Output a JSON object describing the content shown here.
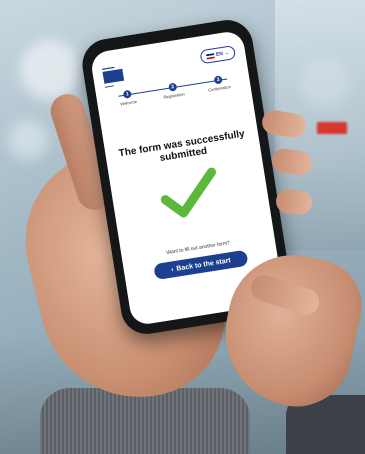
{
  "header": {
    "language_code": "EN"
  },
  "steps": [
    {
      "number": "1",
      "label": "Welcome"
    },
    {
      "number": "2",
      "label": "Registration"
    },
    {
      "number": "3",
      "label": "Confirmation"
    }
  ],
  "main": {
    "title": "The form was successfully submitted",
    "question": "Want to fill out another form?",
    "back_label": "Back to the start",
    "back_icon": "chevron-left-icon",
    "check_icon": "checkmark-icon"
  },
  "colors": {
    "brand": "#1d3f8f",
    "check": "#5cb83c"
  }
}
